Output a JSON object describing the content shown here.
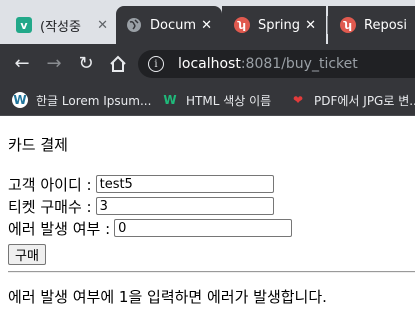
{
  "browser": {
    "tabs": [
      {
        "icon": "v-app-icon",
        "title": "(작성중",
        "close": "✕"
      },
      {
        "icon": "globe-icon",
        "title": "Docum",
        "close": "✕"
      },
      {
        "icon": "spring-icon",
        "title": "Spring",
        "close": "✕"
      },
      {
        "icon": "spring-icon",
        "title": "Reposi",
        "close": ""
      }
    ],
    "url": {
      "host": "localhost",
      "rest": ":8081/buy_ticket"
    },
    "bookmarks": [
      {
        "icon": "wordpress-icon",
        "label": "한글 Lorem Ipsum..."
      },
      {
        "icon": "w-icon",
        "label": "HTML 색상 이름"
      },
      {
        "icon": "heart-icon",
        "label": "PDF에서 JPG로 변..."
      }
    ]
  },
  "page": {
    "heading": "카드 결제",
    "fields": [
      {
        "label": "고객 아이디 :",
        "value": "test5"
      },
      {
        "label": "티켓 구매수 :",
        "value": "3"
      },
      {
        "label": "에러 발생 여부 :",
        "value": "0"
      }
    ],
    "buy_label": "구매",
    "note": "에러 발생 여부에 1을 입력하면 에러가 발생합니다."
  },
  "colors": {
    "tab_bar": "#dee1e6",
    "toolbar": "#35363a",
    "omnibox": "#202124",
    "v_icon": "#22a889",
    "spring_icon": "#e05a4f"
  }
}
